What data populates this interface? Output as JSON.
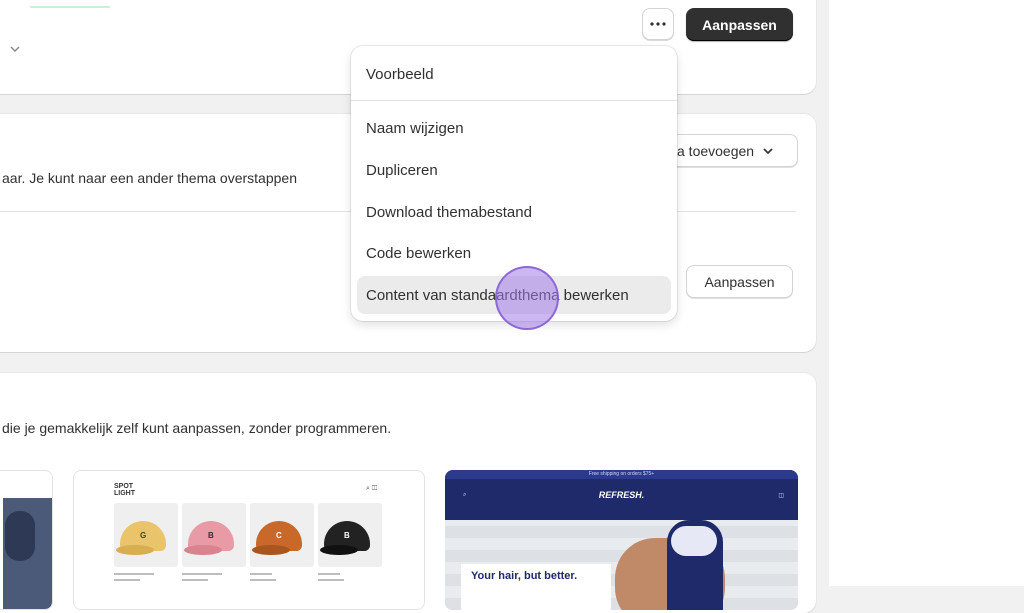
{
  "header": {
    "more_icon": "more-horizontal-icon",
    "primary_button_label": "Aanpassen"
  },
  "dropdown_menu": {
    "items": [
      {
        "label": "Voorbeeld"
      },
      {
        "label": "Naam wijzigen"
      },
      {
        "label": "Dupliceren"
      },
      {
        "label": "Download themabestand"
      },
      {
        "label": "Code bewerken"
      },
      {
        "label": "Content van standaardthema bewerken",
        "highlighted": true
      }
    ]
  },
  "theme_library": {
    "add_theme_button_label": "a toevoegen",
    "description": "aar. Je kunt naar een ander thema overstappen",
    "secondary_button_label": "Aanpassen"
  },
  "free_themes": {
    "description": "die je gemakkelijk zelf kunt aanpassen, zonder programmeren.",
    "thumbnails": [
      {
        "brand": "",
        "caps": []
      },
      {
        "brand": "SPOT LIGHT",
        "caps": [
          {
            "color": "#e9c46a",
            "letter": "G"
          },
          {
            "color": "#e89aa5",
            "letter": "B"
          },
          {
            "color": "#c8692a",
            "letter": "C"
          },
          {
            "color": "#222222",
            "letter": "B"
          }
        ]
      },
      {
        "brand": "REFRESH.",
        "announcement": "Free shipping on orders $75+",
        "hero_text": "Your hair, but better.",
        "accent": "#1f2a6b"
      }
    ]
  },
  "colors": {
    "primary_button": "#303030",
    "menu_highlight": "#ebebeb",
    "cursor": "#a37ce8"
  }
}
